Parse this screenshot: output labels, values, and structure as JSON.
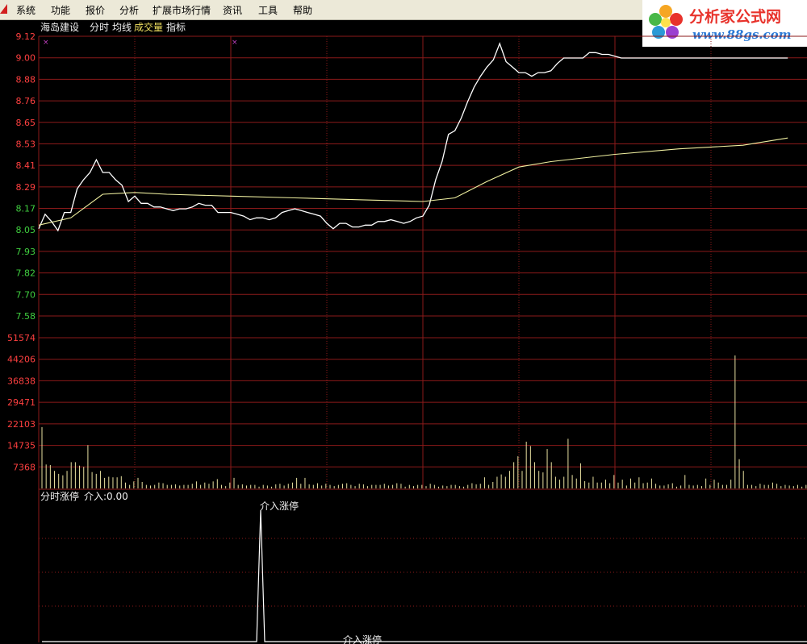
{
  "menu": {
    "items": [
      "系统",
      "功能",
      "报价",
      "分析",
      "扩展市场行情",
      "资讯",
      "工具",
      "帮助"
    ]
  },
  "logo": {
    "text": "分析家公式网",
    "url": "www.88gs.com"
  },
  "header": {
    "stock_name": "海岛建设",
    "time_label": "分时",
    "avg_label": "均线",
    "volume_label": "成交量",
    "indicator_label": "指标"
  },
  "indicator_panel": {
    "title": "分时涨停",
    "value_label": "介入:0.00",
    "top_annotation": "介入涨停",
    "bottom_annotation": "介入涨停"
  },
  "colors": {
    "price_line": "#ffffff",
    "avg_line": "#f0f0a0",
    "grid": "#8b1a1a",
    "grid_dotted": "#8b1a1a",
    "axis_up": "#ff4040",
    "axis_down": "#40d040",
    "axis_volume": "#ff4040",
    "header_yellow": "#f0e060",
    "marker": "#c040c0"
  },
  "chart_data": {
    "type": "line",
    "title": "",
    "xlabel": "",
    "ylabel": "",
    "price_axis_ticks": [
      "9.12",
      "9.00",
      "8.88",
      "8.76",
      "8.65",
      "8.53",
      "8.41",
      "8.29",
      "8.17",
      "8.05",
      "7.93",
      "7.82",
      "7.70",
      "7.58"
    ],
    "price_up_count": 8,
    "price_ylim": [
      7.58,
      9.12
    ],
    "volume_axis_ticks": [
      "51574",
      "44206",
      "36838",
      "29471",
      "22103",
      "14735",
      "7368"
    ],
    "volume_ylim": [
      0,
      58942
    ],
    "minutes_total": 240,
    "series": [
      {
        "role": "price",
        "x": [
          0,
          2,
          4,
          6,
          8,
          10,
          12,
          14,
          16,
          18,
          20,
          22,
          24,
          26,
          28,
          30,
          32,
          34,
          36,
          38,
          40,
          42,
          44,
          46,
          48,
          50,
          52,
          54,
          56,
          58,
          60,
          62,
          64,
          66,
          68,
          70,
          72,
          74,
          76,
          78,
          80,
          82,
          84,
          86,
          88,
          90,
          92,
          94,
          96,
          98,
          100,
          102,
          104,
          106,
          108,
          110,
          112,
          114,
          116,
          118,
          120,
          122,
          124,
          126,
          128,
          130,
          132,
          134,
          136,
          138,
          140,
          142,
          144,
          146,
          148,
          150,
          152,
          154,
          156,
          158,
          160,
          162,
          164,
          166,
          168,
          170,
          172,
          174,
          176,
          178,
          180,
          182,
          184,
          186,
          188,
          190,
          192,
          194,
          196,
          198,
          200,
          202,
          204,
          206,
          208,
          210,
          212,
          214,
          216,
          218,
          220,
          222,
          224,
          226,
          228,
          230,
          232,
          234
        ],
        "values": [
          8.06,
          8.14,
          8.1,
          8.05,
          8.15,
          8.15,
          8.28,
          8.33,
          8.37,
          8.44,
          8.37,
          8.37,
          8.33,
          8.3,
          8.21,
          8.24,
          8.2,
          8.2,
          8.18,
          8.18,
          8.17,
          8.16,
          8.17,
          8.17,
          8.18,
          8.2,
          8.19,
          8.19,
          8.15,
          8.15,
          8.15,
          8.14,
          8.13,
          8.11,
          8.12,
          8.12,
          8.11,
          8.12,
          8.15,
          8.16,
          8.17,
          8.16,
          8.15,
          8.14,
          8.13,
          8.09,
          8.06,
          8.09,
          8.09,
          8.07,
          8.07,
          8.08,
          8.08,
          8.1,
          8.1,
          8.11,
          8.1,
          8.09,
          8.1,
          8.12,
          8.13,
          8.19,
          8.33,
          8.43,
          8.58,
          8.6,
          8.67,
          8.76,
          8.84,
          8.9,
          8.95,
          8.99,
          9.08,
          8.98,
          8.95,
          8.92,
          8.92,
          8.9,
          8.92,
          8.92,
          8.93,
          8.97,
          9.0,
          9.0,
          9.0,
          9.0,
          9.03,
          9.03,
          9.02,
          9.02,
          9.01,
          9.0,
          9.0,
          9.0,
          9.0,
          9.0,
          9.0,
          9.0,
          9.0,
          9.0,
          9.0,
          9.0,
          9.0,
          9.0,
          9.0,
          9.0,
          9.0,
          9.0,
          9.0,
          9.0,
          9.0,
          9.0,
          9.0,
          9.0,
          9.0,
          9.0,
          9.0,
          9.0
        ],
        "name": ""
      },
      {
        "role": "average",
        "x": [
          0,
          10,
          20,
          30,
          40,
          60,
          80,
          100,
          120,
          130,
          140,
          150,
          160,
          170,
          180,
          200,
          220,
          234
        ],
        "values": [
          8.08,
          8.12,
          8.25,
          8.26,
          8.25,
          8.24,
          8.23,
          8.22,
          8.21,
          8.23,
          8.32,
          8.4,
          8.43,
          8.45,
          8.47,
          8.5,
          8.52,
          8.56
        ],
        "name": ""
      }
    ],
    "volumes": [
      21000,
      8200,
      8000,
      6000,
      5000,
      4500,
      6000,
      9000,
      9000,
      7800,
      7400,
      14800,
      5600,
      5000,
      6000,
      3600,
      4000,
      3800,
      3800,
      4200,
      2000,
      1200,
      2400,
      3600,
      2200,
      1200,
      1000,
      1200,
      2000,
      1800,
      1200,
      1200,
      1400,
      1000,
      1200,
      1200,
      1600,
      2400,
      1200,
      2000,
      1600,
      2400,
      3200,
      1200,
      800,
      2000,
      3600,
      1200,
      1400,
      1000,
      1200,
      1200,
      600,
      1200,
      1000,
      600,
      1400,
      1600,
      1000,
      1600,
      2000,
      3600,
      1600,
      3600,
      1400,
      1200,
      1800,
      1000,
      1600,
      1200,
      800,
      1200,
      1600,
      1800,
      1200,
      800,
      1600,
      1400,
      800,
      1200,
      1200,
      1200,
      1600,
      1000,
      1200,
      1800,
      1600,
      600,
      1200,
      800,
      1200,
      1200,
      800,
      1600,
      1200,
      600,
      1000,
      800,
      1200,
      1200,
      800,
      600,
      1200,
      1800,
      1400,
      1600,
      3800,
      1200,
      2200,
      4000,
      4800,
      4000,
      6000,
      9000,
      11000,
      6000,
      16000,
      14500,
      9000,
      6000,
      5500,
      13500,
      9000,
      4000,
      3000,
      4000,
      17000,
      4600,
      3400,
      8600,
      2500,
      2000,
      4000,
      2000,
      2000,
      3000,
      1800,
      4600,
      2000,
      3000,
      1000,
      3400,
      2000,
      3800,
      1800,
      2000,
      3400,
      1600,
      1000,
      1000,
      1400,
      1800,
      600,
      1000,
      4600,
      1200,
      1000,
      1200,
      800,
      3400,
      1200,
      3000,
      2000,
      1200,
      1200,
      3000,
      45500,
      10000,
      6000,
      1200,
      1200,
      800,
      1600,
      1200,
      1200,
      2000,
      1600,
      800,
      1200,
      1000,
      800,
      1200,
      600,
      1200
    ]
  }
}
